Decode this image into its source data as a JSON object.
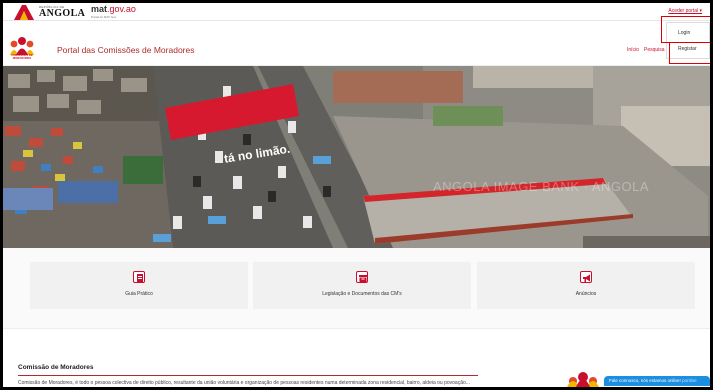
{
  "govbar": {
    "country_small": "REPÚBLICA DE",
    "country": "ANGOLA",
    "domain_name": "mat",
    "domain_tld": ".gov.ao",
    "domain_sub": "Portal do MAT Gov",
    "access_portal": "Aceder portal ▾"
  },
  "dropdown": {
    "login": "Login",
    "register": "Registar"
  },
  "header": {
    "logo_text": "COMISSÕES DE MORADORES",
    "title": "Portal das Comissões de Moradores",
    "nav": {
      "home": "Início",
      "search": "Pesquisa"
    }
  },
  "hero": {
    "billboard": "tá no limão.",
    "watermark": "ANGOLA IMAGE BANK · ANGOLA"
  },
  "cards": [
    {
      "label": "Guia Prático",
      "icon": "document-icon"
    },
    {
      "label": "Legislação e Documentos das CM's",
      "icon": "folder-icon"
    },
    {
      "label": "Anúncios",
      "icon": "megaphone-icon"
    }
  ],
  "section": {
    "title": "Comissão de Moradores",
    "text": "Comissão de Moradores, é todo o pessoa colectiva de direito público, resultante da união voluntária e organização de pessoas residentes numa determinada zona residencial, bairro, aldeia ou povoação..."
  },
  "chat": {
    "text": "Fale connosco, nós estamos online!",
    "status": "ponline"
  },
  "colors": {
    "brand_red": "#c8102e",
    "title_red": "#b22a2a",
    "chat_blue": "#1d8fe0"
  }
}
